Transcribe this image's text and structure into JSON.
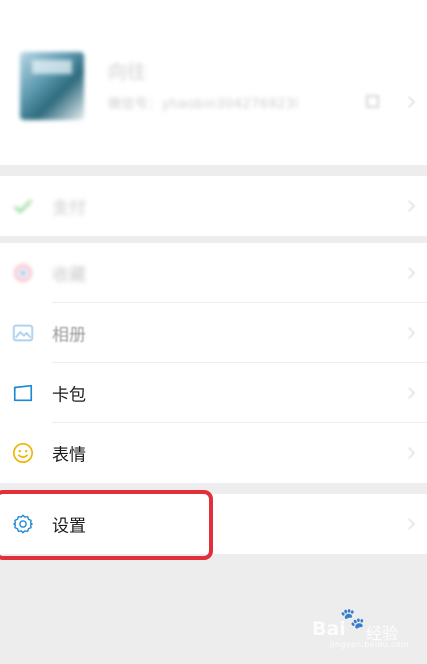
{
  "profile": {
    "name": "向往",
    "wechat_id": "微信号：yhaobin304276923l",
    "avatar_icon": "avatar-image"
  },
  "menu": {
    "pay": {
      "label": "支付",
      "icon": "pay-icon"
    },
    "favorites": {
      "label": "收藏",
      "icon": "favorites-icon"
    },
    "album": {
      "label": "相册",
      "icon": "album-icon"
    },
    "cards": {
      "label": "卡包",
      "icon": "card-wallet-icon"
    },
    "stickers": {
      "label": "表情",
      "icon": "smiley-icon"
    },
    "settings": {
      "label": "设置",
      "icon": "gear-icon"
    }
  },
  "colors": {
    "highlight": "#e2303a",
    "icon_blue": "#1e8ad6",
    "icon_yellow": "#f0b400",
    "pay_green": "#1aad19"
  },
  "watermark": {
    "brand": "Bai",
    "paw": "🐾",
    "tail": "经验",
    "url": "jingyan.baidu.com"
  }
}
